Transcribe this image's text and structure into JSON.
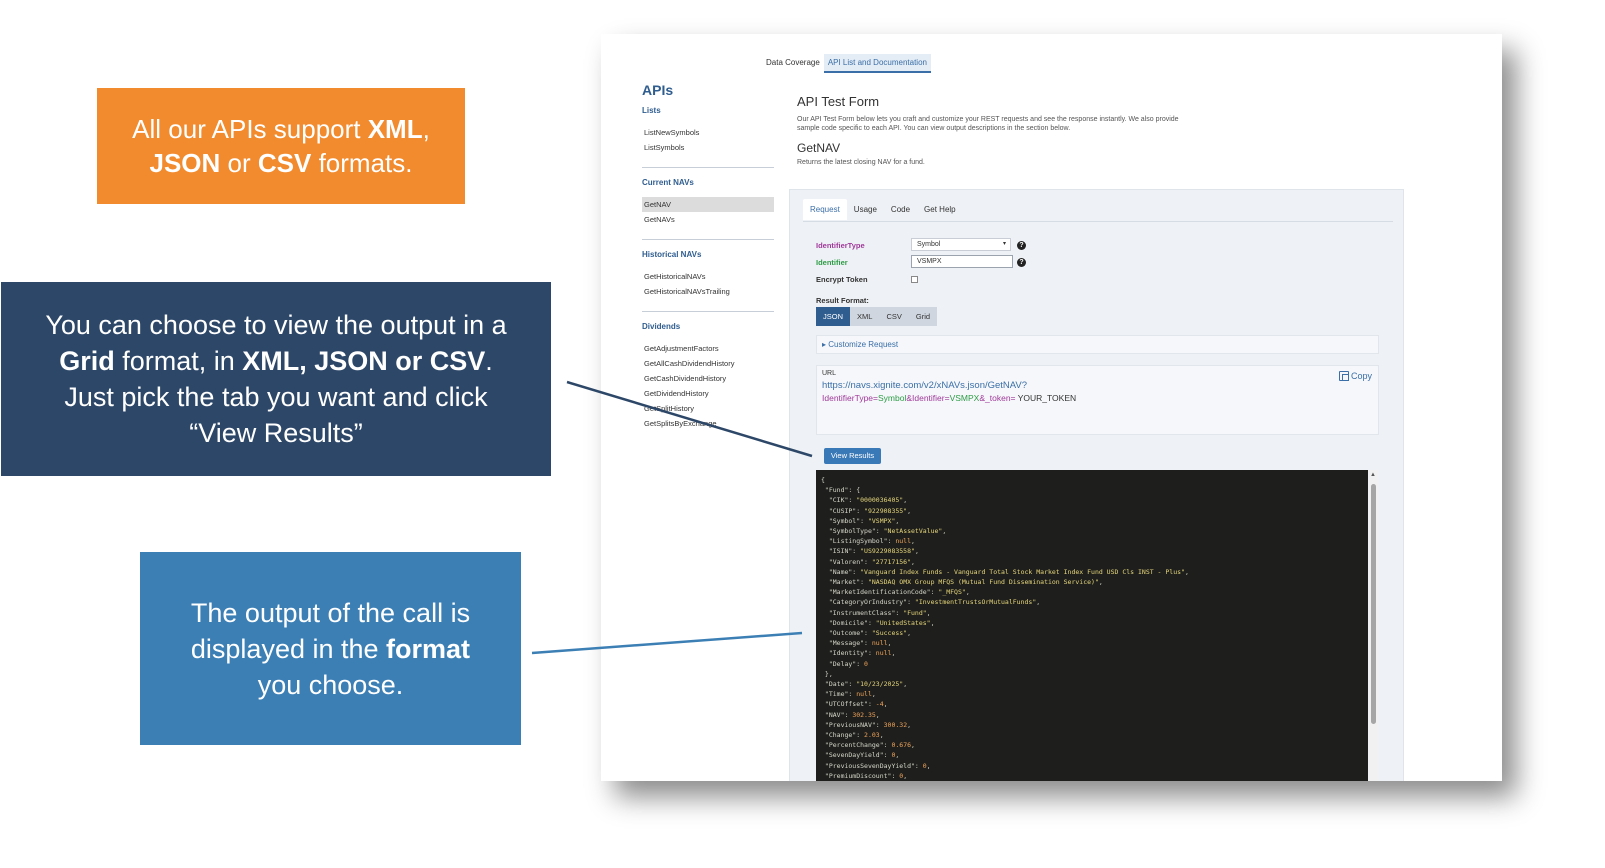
{
  "callouts": {
    "orange": {
      "l1_a": "All our APIs support ",
      "l1_b": "XML",
      "l1_c": ",",
      "l2_a": "JSON",
      "l2_b": " or ",
      "l2_c": "CSV",
      "l2_d": " formats."
    },
    "navy": {
      "l1": "You can choose to view the output in a",
      "l2_a": "Grid",
      "l2_b": " format, in ",
      "l2_c": "XML, JSON or CSV",
      "l2_d": ".",
      "l3": "Just pick the tab you want and click",
      "l4": "“View Results”"
    },
    "blue": {
      "l1": "The output of the call is",
      "l2_a": "displayed in the ",
      "l2_b": "format",
      "l3": "you choose."
    }
  },
  "top_tabs": [
    "Data Coverage",
    "API List and Documentation"
  ],
  "sidebar": {
    "title": "APIs",
    "sections": [
      {
        "label": "Lists",
        "items": [
          "ListNewSymbols",
          "ListSymbols"
        ]
      },
      {
        "label": "Current NAVs",
        "items": [
          "GetNAV",
          "GetNAVs"
        ]
      },
      {
        "label": "Historical NAVs",
        "items": [
          "GetHistoricalNAVs",
          "GetHistoricalNAVsTrailing"
        ]
      },
      {
        "label": "Dividends",
        "items": [
          "GetAdjustmentFactors",
          "GetAllCashDividendHistory",
          "GetCashDividendHistory",
          "GetDividendHistory",
          "GetSplitHistory",
          "GetSplitsByExchange"
        ]
      }
    ]
  },
  "main": {
    "title": "API Test Form",
    "description": "Our API Test Form below lets you craft and customize your REST requests and see the response instantly. We also provide sample code specific to each API. You can view output descriptions in the section below.",
    "endpoint": "GetNAV",
    "endpoint_desc": "Returns the latest closing NAV for a fund."
  },
  "form": {
    "tabs": [
      "Request",
      "Usage",
      "Code",
      "Get Help"
    ],
    "identifier_type_label": "IdentifierType",
    "identifier_type_value": "Symbol",
    "identifier_label": "Identifier",
    "identifier_value": "VSMPX",
    "encrypt_label": "Encrypt Token",
    "result_format_label": "Result Format:",
    "formats": [
      "JSON",
      "XML",
      "CSV",
      "Grid"
    ],
    "customize_label": "Customize Request",
    "url_label": "URL",
    "url_base": "https://navs.xignite.com/v2/xNAVs.json/GetNAV?",
    "url_p1": "IdentifierType=",
    "url_v1": "Symbol",
    "url_p2": "&Identifier=",
    "url_v2": "VSMPX",
    "url_p3": "&_token=",
    "url_v3": " YOUR_TOKEN",
    "copy_label": "Copy",
    "view_results": "View Results"
  },
  "output": [
    {
      "t": "{"
    },
    {
      "t": " \"Fund\": {"
    },
    {
      "k": "  \"CIK\": ",
      "s": "\"0000036405\"",
      "e": ","
    },
    {
      "k": "  \"CUSIP\": ",
      "s": "\"922908355\"",
      "e": ","
    },
    {
      "k": "  \"Symbol\": ",
      "s": "\"VSMPX\"",
      "e": ","
    },
    {
      "k": "  \"SymbolType\": ",
      "s": "\"NetAssetValue\"",
      "e": ","
    },
    {
      "k": "  \"ListingSymbol\": ",
      "n": "null",
      "e": ","
    },
    {
      "k": "  \"ISIN\": ",
      "s": "\"US9229083558\"",
      "e": ","
    },
    {
      "k": "  \"Valoren\": ",
      "s": "\"27717156\"",
      "e": ","
    },
    {
      "k": "  \"Name\": ",
      "s": "\"Vanguard Index Funds - Vanguard Total Stock Market Index Fund USD Cls INST - Plus\"",
      "e": ","
    },
    {
      "k": "  \"Market\": ",
      "s": "\"NASDAQ OMX Group MFQS (Mutual Fund Dissemination Service)\"",
      "e": ","
    },
    {
      "k": "  \"MarketIdentificationCode\": ",
      "s": "\"_MFQS\"",
      "e": ","
    },
    {
      "k": "  \"CategoryOrIndustry\": ",
      "s": "\"InvestmentTrustsOrMutualFunds\"",
      "e": ","
    },
    {
      "k": "  \"InstrumentClass\": ",
      "s": "\"Fund\"",
      "e": ","
    },
    {
      "k": "  \"Domicile\": ",
      "s": "\"UnitedStates\"",
      "e": ","
    },
    {
      "k": "  \"Outcome\": ",
      "s": "\"Success\"",
      "e": ","
    },
    {
      "k": "  \"Message\": ",
      "n": "null",
      "e": ","
    },
    {
      "k": "  \"Identity\": ",
      "n": "null",
      "e": ","
    },
    {
      "k": "  \"Delay\": ",
      "n": "0"
    },
    {
      "t": " },"
    },
    {
      "k": " \"Date\": ",
      "s": "\"10/23/2025\"",
      "e": ","
    },
    {
      "k": " \"Time\": ",
      "n": "null",
      "e": ","
    },
    {
      "k": " \"UTCOffset\": ",
      "n": "-4",
      "e": ","
    },
    {
      "k": " \"NAV\": ",
      "n": "302.35",
      "e": ","
    },
    {
      "k": " \"PreviousNAV\": ",
      "n": "300.32",
      "e": ","
    },
    {
      "k": " \"Change\": ",
      "n": "2.03",
      "e": ","
    },
    {
      "k": " \"PercentChange\": ",
      "n": "0.676",
      "e": ","
    },
    {
      "k": " \"SevenDayYield\": ",
      "n": "0",
      "e": ","
    },
    {
      "k": " \"PreviousSevenDayYield\": ",
      "n": "0",
      "e": ","
    },
    {
      "k": " \"PremiumDiscount\": ",
      "n": "0",
      "e": ","
    }
  ]
}
